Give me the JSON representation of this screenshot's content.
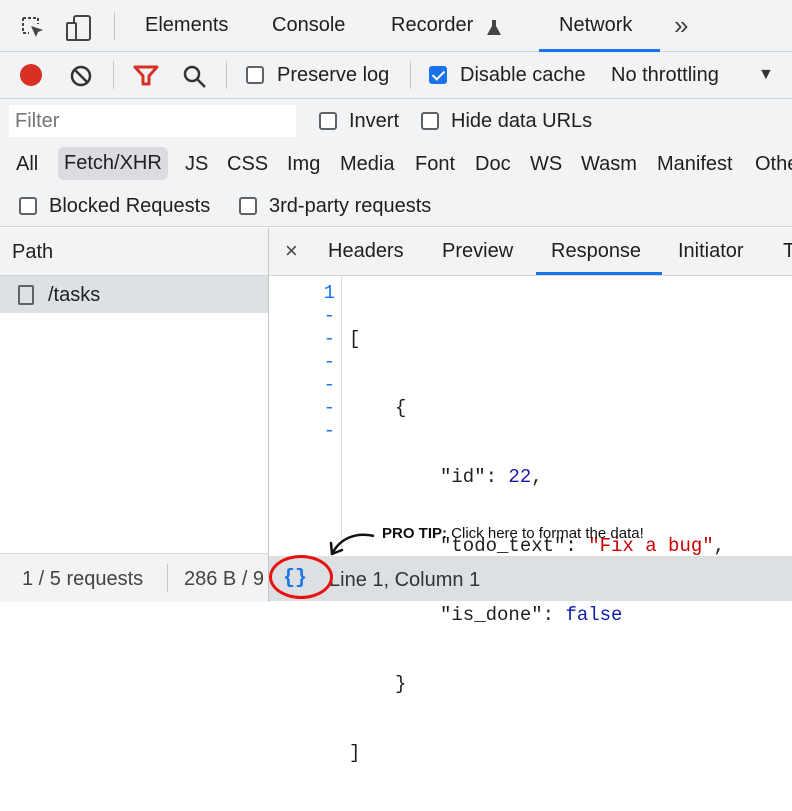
{
  "top_tabs": [
    "Elements",
    "Console",
    "Recorder",
    "Network"
  ],
  "more_tabs": "»",
  "toolbar": {
    "preserve_log": "Preserve log",
    "disable_cache": "Disable cache",
    "throttling": "No throttling"
  },
  "filter": {
    "placeholder": "Filter",
    "invert": "Invert",
    "hide_data_urls": "Hide data URLs"
  },
  "type_filters": [
    "All",
    "Fetch/XHR",
    "JS",
    "CSS",
    "Img",
    "Media",
    "Font",
    "Doc",
    "WS",
    "Wasm",
    "Manifest",
    "Othe"
  ],
  "extra_filters": {
    "blocked": "Blocked Requests",
    "third_party": "3rd-party requests"
  },
  "requests": {
    "header": "Path",
    "items": [
      "/tasks"
    ]
  },
  "detail_tabs": [
    "Headers",
    "Preview",
    "Response",
    "Initiator",
    "T"
  ],
  "response": {
    "line_numbers": [
      "1",
      "-",
      "-",
      "-",
      "-",
      "-",
      "-"
    ],
    "open_bracket": "[",
    "open_brace": "{",
    "id_key": "\"id\"",
    "id_val": "22",
    "text_key": "\"todo_text\"",
    "text_val": "\"Fix a bug\"",
    "done_key": "\"is_done\"",
    "done_val": "false",
    "close_brace": "}",
    "close_bracket": "]",
    "colon": ": ",
    "comma": ","
  },
  "status": {
    "requests": "1 / 5 requests",
    "size": "286 B / 9",
    "format_glyph": "{}",
    "cursor": "Line 1, Column 1"
  },
  "annotation": {
    "bold": "PRO TIP:",
    "rest": " Click here to format the data!"
  },
  "colors": {
    "accent": "#1a73e8",
    "record": "#d93025",
    "annotation_circle": "#e8110f",
    "string": "#c80000",
    "number": "#1a1aa6",
    "keyword": "#0d22aa"
  }
}
